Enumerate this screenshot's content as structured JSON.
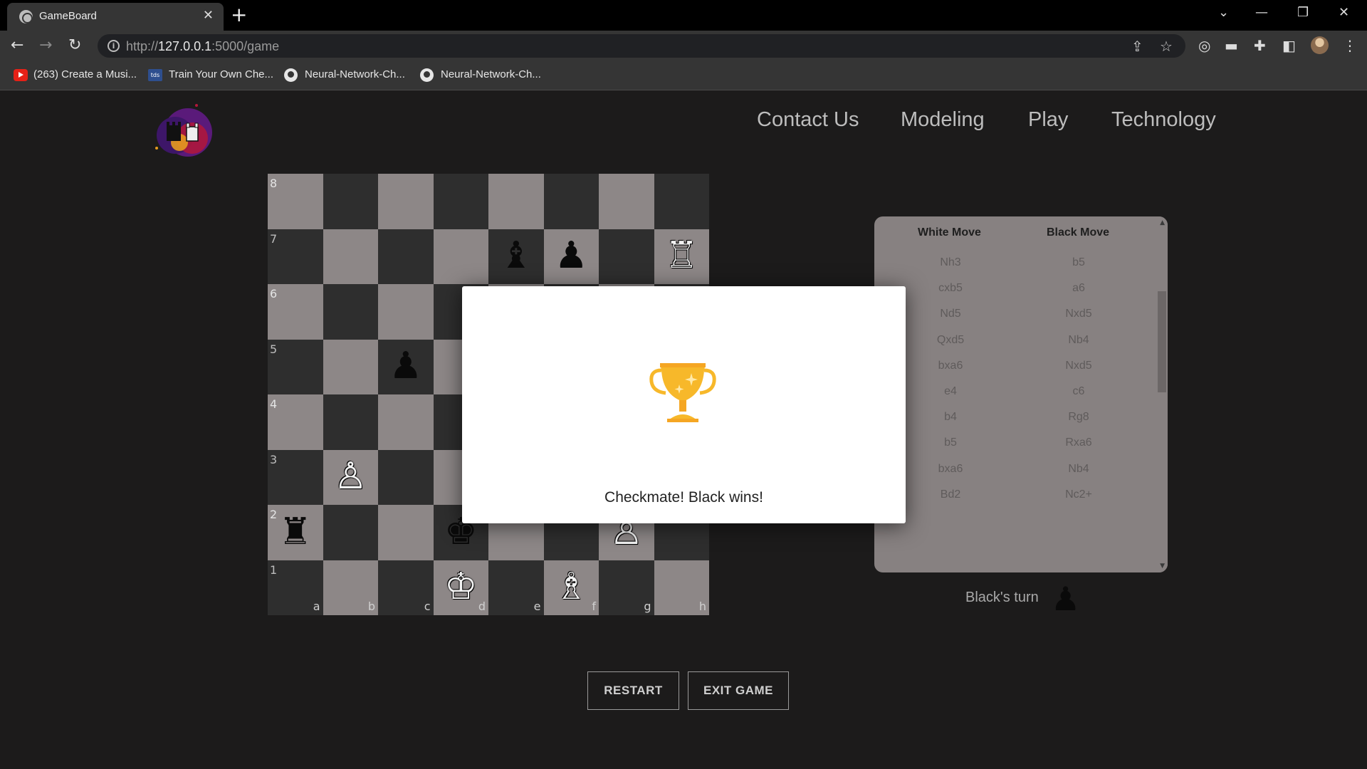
{
  "browser": {
    "tab_title": "GameBoard",
    "tab_close": "✕",
    "new_tab": "+",
    "url_prefix": "http://",
    "url_host": "127.0.0.1",
    "url_rest": ":5000/game",
    "window_controls": {
      "chevron": "⌄",
      "minimize": "—",
      "restore": "❐",
      "close": "✕"
    },
    "bookmarks": [
      {
        "label": "(263) Create a Musi...",
        "icon": "youtube-icon"
      },
      {
        "label": "Train Your Own Che...",
        "icon": "tds-icon"
      },
      {
        "label": "Neural-Network-Ch...",
        "icon": "github-icon"
      },
      {
        "label": "Neural-Network-Ch...",
        "icon": "github-icon"
      }
    ]
  },
  "nav": {
    "links": [
      "Contact Us",
      "Modeling",
      "Play",
      "Technology"
    ]
  },
  "board": {
    "ranks": [
      "8",
      "7",
      "6",
      "5",
      "4",
      "3",
      "2",
      "1"
    ],
    "files": [
      "a",
      "b",
      "c",
      "d",
      "e",
      "f",
      "g",
      "h"
    ],
    "pieces": [
      {
        "square": "e7",
        "glyph": "♝",
        "color": "black"
      },
      {
        "square": "f7",
        "glyph": "♟",
        "color": "black"
      },
      {
        "square": "h7",
        "glyph": "♖",
        "color": "white"
      },
      {
        "square": "c5",
        "glyph": "♟",
        "color": "black"
      },
      {
        "square": "b3",
        "glyph": "♙",
        "color": "white"
      },
      {
        "square": "a2",
        "glyph": "♜",
        "color": "black"
      },
      {
        "square": "d2",
        "glyph": "♚",
        "color": "black"
      },
      {
        "square": "g2",
        "glyph": "♙",
        "color": "white"
      },
      {
        "square": "d1",
        "glyph": "♔",
        "color": "white"
      },
      {
        "square": "f1",
        "glyph": "♗",
        "color": "white"
      }
    ]
  },
  "moves": {
    "white_header": "White Move",
    "black_header": "Black Move",
    "rows": [
      {
        "white": "Nh3",
        "black": "b5"
      },
      {
        "white": "cxb5",
        "black": "a6"
      },
      {
        "white": "Nd5",
        "black": "Nxd5"
      },
      {
        "white": "Qxd5",
        "black": "Nb4"
      },
      {
        "white": "bxa6",
        "black": "Nxd5"
      },
      {
        "white": "e4",
        "black": "c6"
      },
      {
        "white": "b4",
        "black": "Rg8"
      },
      {
        "white": "b5",
        "black": "Rxa6"
      },
      {
        "white": "bxa6",
        "black": "Nb4"
      },
      {
        "white": "Bd2",
        "black": "Nc2+"
      }
    ]
  },
  "turn": {
    "label": "Black's turn",
    "glyph": "♟"
  },
  "buttons": {
    "restart": "RESTART",
    "exit": "EXIT GAME"
  },
  "modal": {
    "message": "Checkmate! Black wins!",
    "icon": "trophy-icon"
  }
}
